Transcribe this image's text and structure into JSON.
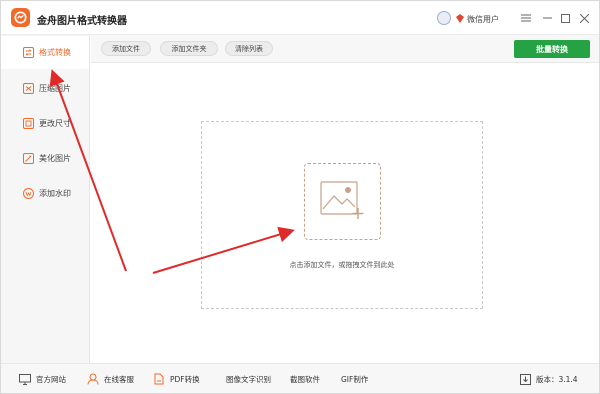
{
  "app": {
    "title": "金舟图片格式转换器",
    "user_name": "微信用户",
    "accent_color": "#f26a2a",
    "primary_button_color": "#25a244"
  },
  "window_controls": [
    "menu-icon",
    "minimize-icon",
    "maximize-icon",
    "close-icon"
  ],
  "sidebar": {
    "items": [
      {
        "label": "格式转换",
        "icon": "convert-icon",
        "active": true
      },
      {
        "label": "压缩图片",
        "icon": "compress-icon",
        "active": false
      },
      {
        "label": "更改尺寸",
        "icon": "resize-icon",
        "active": false
      },
      {
        "label": "美化图片",
        "icon": "beautify-icon",
        "active": false
      },
      {
        "label": "添加水印",
        "icon": "watermark-icon",
        "active": false
      }
    ]
  },
  "toolbar": {
    "add_file": "添加文件",
    "add_folder": "添加文件夹",
    "clear_list": "清除列表",
    "batch_convert": "批量转换"
  },
  "main": {
    "drop_hint": "点击添加文件，或拖拽文件到此处",
    "drop_icon": "add-image-icon"
  },
  "statusbar": {
    "site": "官方网站",
    "service": "在线客服",
    "pdf": "PDF转换",
    "ocr": "图像文字识别",
    "screenshot": "截图软件",
    "gif": "GIF制作",
    "version": "版本：3.1.4"
  }
}
